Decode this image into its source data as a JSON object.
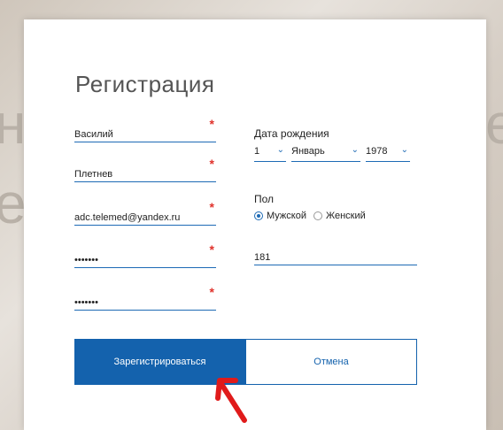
{
  "background": {
    "left_text": "н",
    "left_text2": "е",
    "right_text": "е"
  },
  "dialog": {
    "title": "Регистрация",
    "first_name": "Василий",
    "last_name": "Плетнев",
    "email": "adc.telemed@yandex.ru",
    "password": "•••••••",
    "password_confirm": "•••••••",
    "required_mark": "*",
    "birth_label": "Дата рождения",
    "birth_day": "1",
    "birth_month": "Январь",
    "birth_year": "1978",
    "gender_label": "Пол",
    "gender_male": "Мужской",
    "gender_female": "Женский",
    "extra_field_value": "181",
    "register_button": "Зарегистрироваться",
    "cancel_button": "Отмена"
  },
  "colors": {
    "primary": "#1462ad",
    "required": "#e0322b",
    "annotation_arrow": "#e01b1b"
  }
}
